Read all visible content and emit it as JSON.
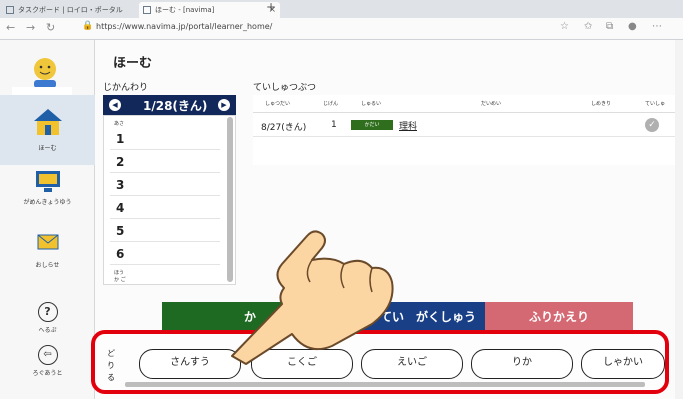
{
  "browser": {
    "tabs": [
      {
        "label": "タスクボード | ロイロ・ポータル",
        "close": "×"
      },
      {
        "label": "ほーむ - [navima]",
        "close": "×"
      }
    ],
    "new_tab": "+",
    "url": "https://www.navima.jp/portal/learner_home/"
  },
  "sidebar": {
    "items": [
      {
        "label": "ほーむ",
        "icon": "house-icon"
      },
      {
        "label": "がめんきょうゆう",
        "icon": "screen-share-icon"
      },
      {
        "label": "おしらせ",
        "icon": "mail-icon"
      },
      {
        "label": "へるぷ",
        "icon": "help-icon"
      },
      {
        "label": "ろぐあうと",
        "icon": "logout-icon"
      }
    ]
  },
  "main": {
    "title": "ほーむ",
    "timetable": {
      "label": "じかんわり",
      "date": "1/28(きん)",
      "morning": "あさ",
      "periods": [
        "1",
        "2",
        "3",
        "4",
        "5",
        "6"
      ],
      "after_school": "ほうか ご"
    },
    "submissions": {
      "label": "ていしゅつぶつ",
      "columns": [
        "しゅつだい",
        "じげん",
        "しゅるい",
        "だいめい",
        "しめきり",
        "ていしゅ"
      ],
      "rows": [
        {
          "date": "8/27(きん)",
          "period": "1",
          "type": "かだい",
          "title": "理科"
        }
      ]
    },
    "buttons": {
      "left": "か",
      "middle": "てい　がくしゅう",
      "right": "ふりかえり"
    }
  },
  "subject_bar": {
    "return_label": "どり る",
    "subjects": [
      "さんすう",
      "こくご",
      "えいご",
      "りか",
      "しゃかい"
    ]
  },
  "colors": {
    "accent_navy": "#13285a",
    "highlight_red": "#e3000d",
    "green": "#1e6a22",
    "blue": "#193f86",
    "pink": "#d46873"
  }
}
